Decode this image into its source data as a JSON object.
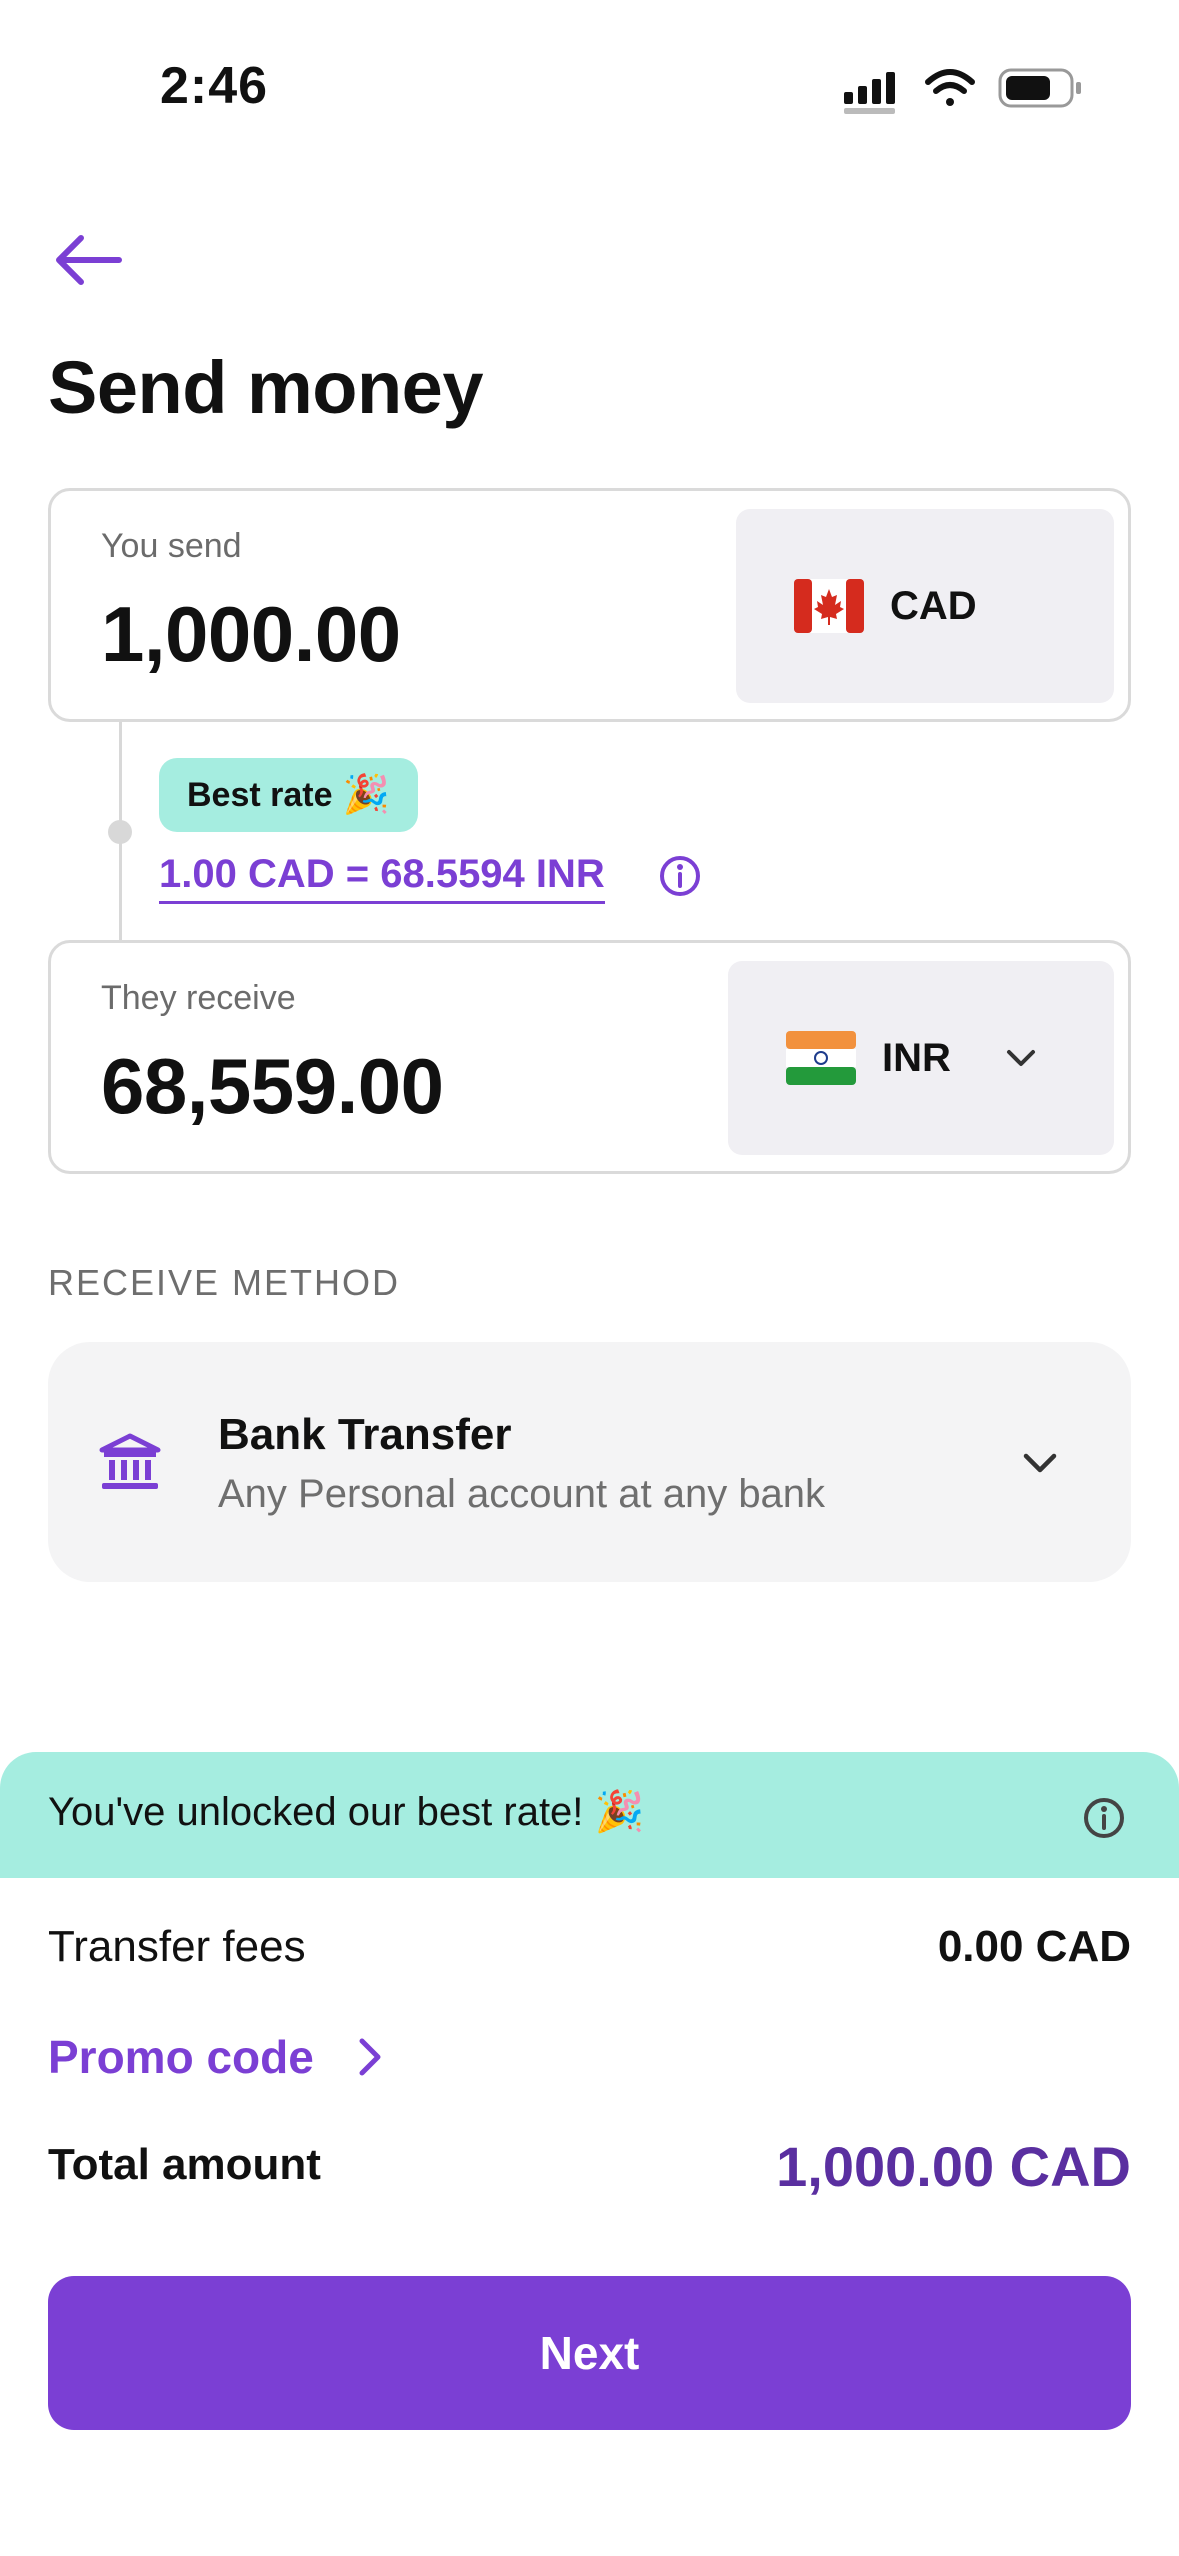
{
  "status_bar": {
    "time": "2:46"
  },
  "header": {
    "title": "Send money"
  },
  "send": {
    "label": "You send",
    "amount": "1,000.00",
    "currency": "CAD"
  },
  "rate": {
    "badge": "Best rate",
    "badge_emoji": "🎉",
    "text": "1.00 CAD = 68.5594 INR"
  },
  "receive": {
    "label": "They receive",
    "amount": "68,559.00",
    "currency": "INR"
  },
  "receive_method": {
    "section_label": "RECEIVE METHOD",
    "title": "Bank Transfer",
    "subtitle": "Any Personal account at any bank"
  },
  "promo_banner": {
    "text": "You've unlocked our best rate! 🎉"
  },
  "summary": {
    "fees_label": "Transfer fees",
    "fees_value": "0.00 CAD",
    "promo_label": "Promo code",
    "total_label": "Total amount",
    "total_value": "1,000.00 CAD"
  },
  "next_label": "Next",
  "colors": {
    "accent": "#7b3fd4",
    "total": "#5a2fa0",
    "mint": "#a5ede0"
  },
  "icons": [
    "signal-icon",
    "wifi-icon",
    "battery-icon",
    "back-arrow-icon",
    "canada-flag-icon",
    "india-flag-icon",
    "chevron-down-icon",
    "info-icon",
    "bank-icon",
    "chevron-right-icon"
  ]
}
